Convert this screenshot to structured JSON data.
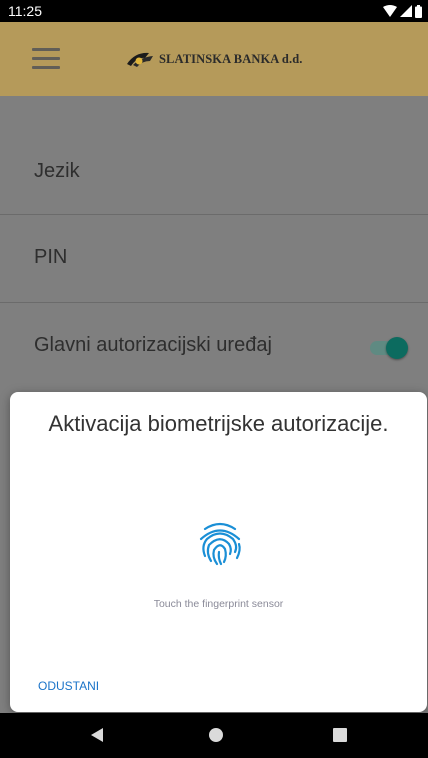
{
  "status_bar": {
    "time": "11:25",
    "icons": [
      "wifi-icon",
      "signal-icon",
      "battery-icon"
    ]
  },
  "app_bar": {
    "brand_name": "SLATINSKA BANKA d.d.",
    "menu_icon": "hamburger-menu-icon",
    "logo_icon": "bank-logo-icon"
  },
  "settings": {
    "items": [
      {
        "label": "Jezik"
      },
      {
        "label": "PIN"
      },
      {
        "label": "Glavni autorizacijski uređaj",
        "toggle_on": true
      }
    ]
  },
  "dialog": {
    "title": "Aktivacija biometrijske autorizacije.",
    "icon": "fingerprint-icon",
    "hint": "Touch the fingerprint sensor",
    "cancel_label": "ODUSTANI"
  },
  "nav_bar": {
    "buttons": [
      "back-icon",
      "home-icon",
      "recents-icon"
    ]
  },
  "colors": {
    "app_bar": "#b59a5a",
    "toggle": "#0c6b5f",
    "accent": "#1a73c8",
    "fingerprint": "#1a8fd6"
  }
}
